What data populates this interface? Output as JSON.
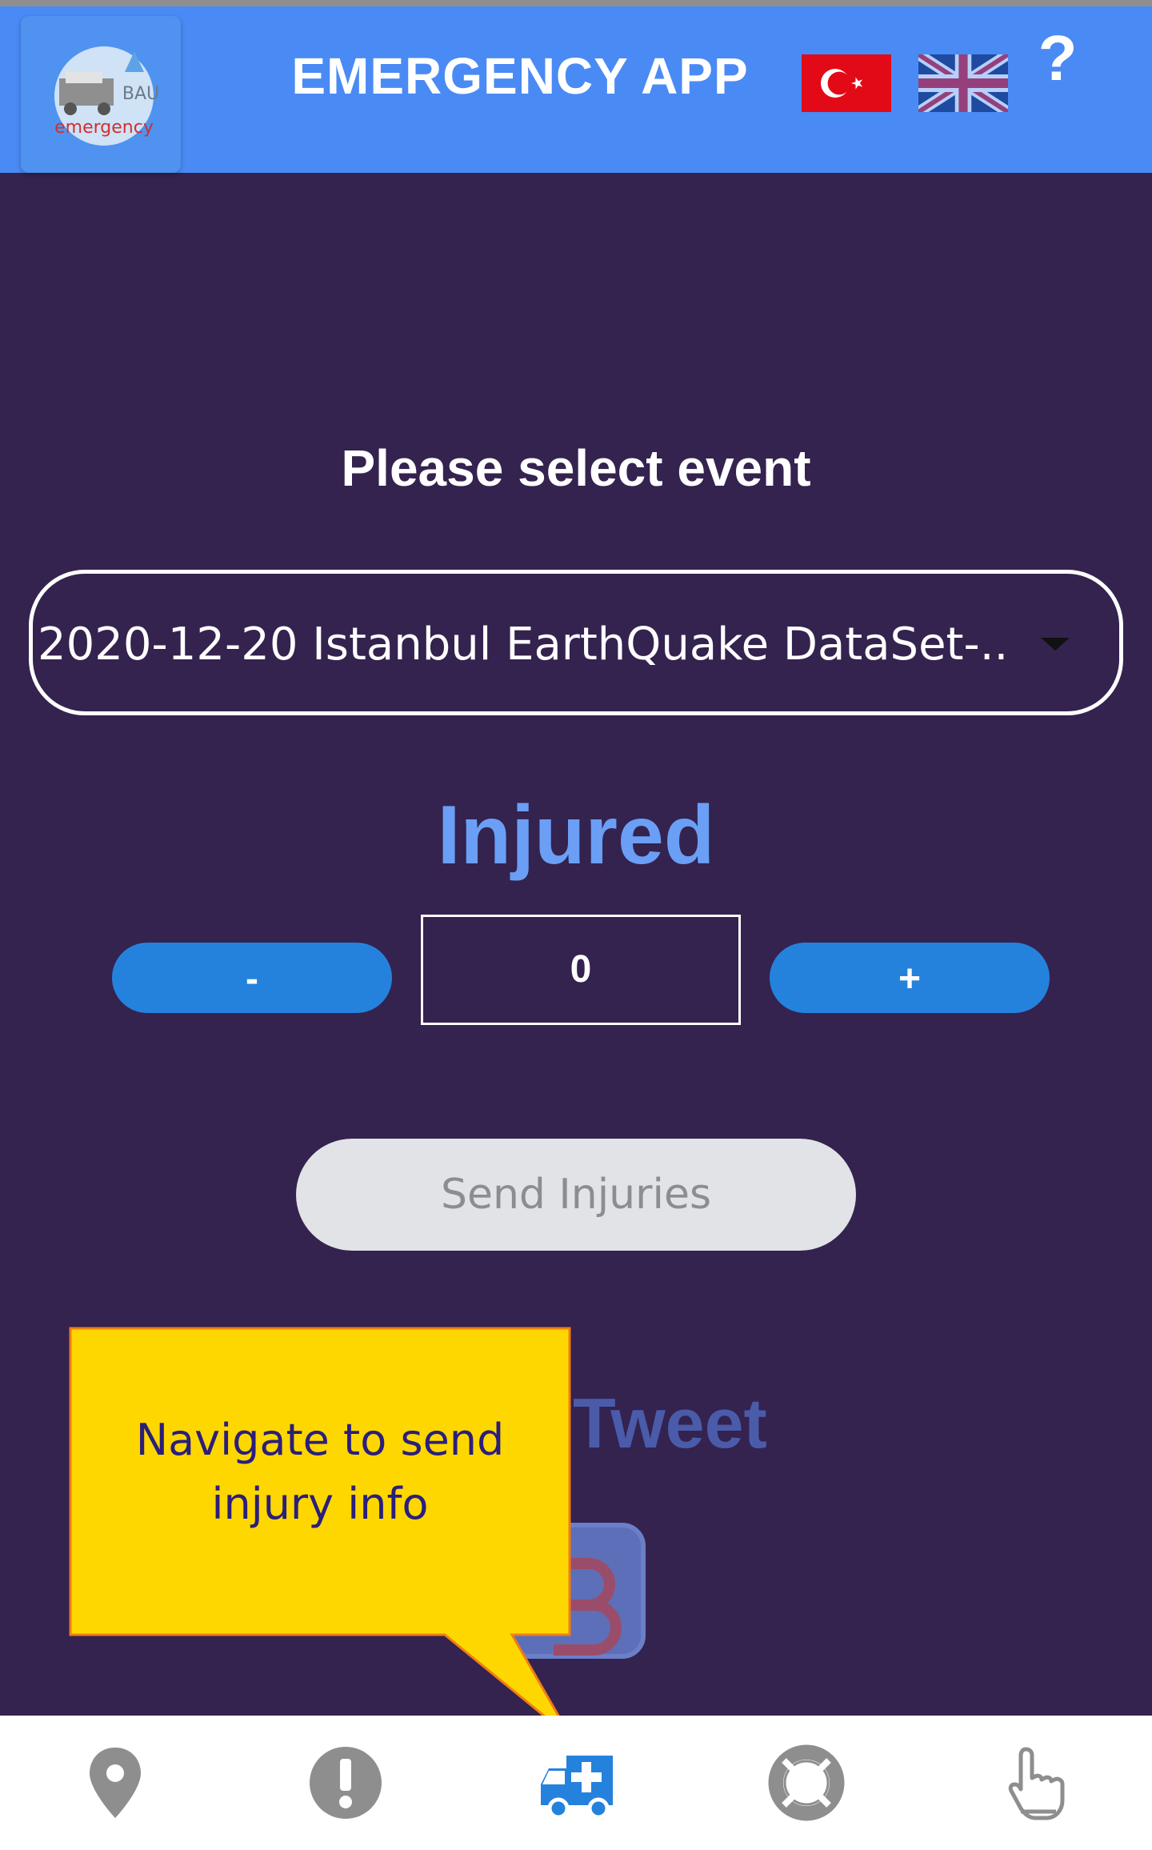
{
  "header": {
    "title": "EMERGENCY APP",
    "logo_text": "emergency",
    "logo_badge": "BAU",
    "help_label": "?"
  },
  "event": {
    "heading": "Please select event",
    "selected": "2020-12-20 Istanbul EarthQuake DataSet-.."
  },
  "injured": {
    "title": "Injured",
    "minus_label": "-",
    "plus_label": "+",
    "count": "0",
    "send_label": "Send Injuries"
  },
  "tweet": {
    "title": "Tweet"
  },
  "tooltip": {
    "text_line1": "Navigate to send",
    "text_line2": "injury info"
  },
  "nav": {
    "items": [
      {
        "icon": "map-pin-icon",
        "active": false
      },
      {
        "icon": "alert-icon",
        "active": false
      },
      {
        "icon": "ambulance-icon",
        "active": true
      },
      {
        "icon": "lifebuoy-icon",
        "active": false
      },
      {
        "icon": "hand-pointer-icon",
        "active": false
      }
    ]
  },
  "colors": {
    "header": "#4a8af4",
    "background": "#34224f",
    "accent": "#2482dc",
    "injured_title": "#6a9ff5",
    "tooltip": "#ffd700",
    "nav_active": "#2482dc",
    "nav_inactive": "#8e8e8e"
  }
}
